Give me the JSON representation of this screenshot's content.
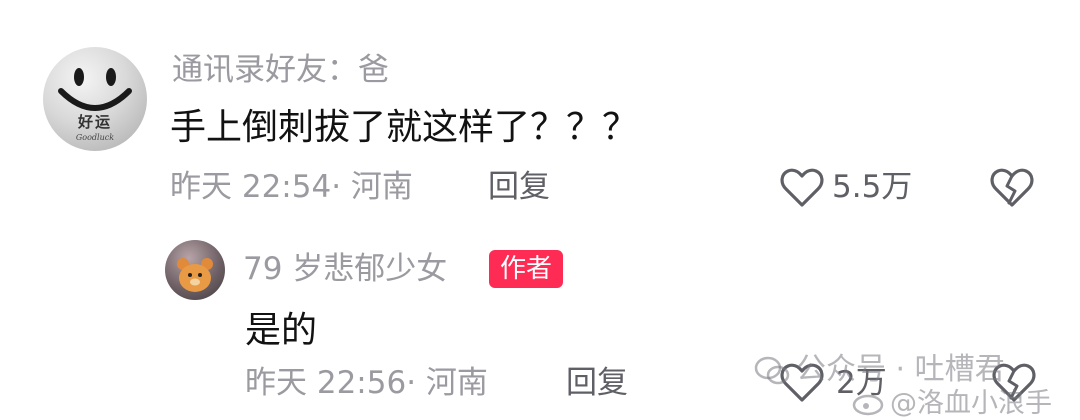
{
  "top_comment": {
    "username": "通讯录好友：爸",
    "text": "手上倒刺拔了就这样了？？？",
    "time_location": "昨天 22:54· 河南",
    "reply_label": "回复",
    "like_count": "5.5万",
    "avatar_lettering": "好运",
    "avatar_caption": "Goodluck"
  },
  "reply_comment": {
    "username": "79 岁悲郁少女",
    "badge": "作者",
    "text": "是的",
    "time_location": "昨天 22:56· 河南",
    "reply_label": "回复",
    "like_count": "2万"
  },
  "watermark": {
    "wechat": "公众号 · 吐槽君",
    "weibo": "@洛血小浪手"
  },
  "colors": {
    "author_badge": "#fe2c55",
    "muted_text": "#9a9aa0",
    "body_text": "#121212"
  }
}
